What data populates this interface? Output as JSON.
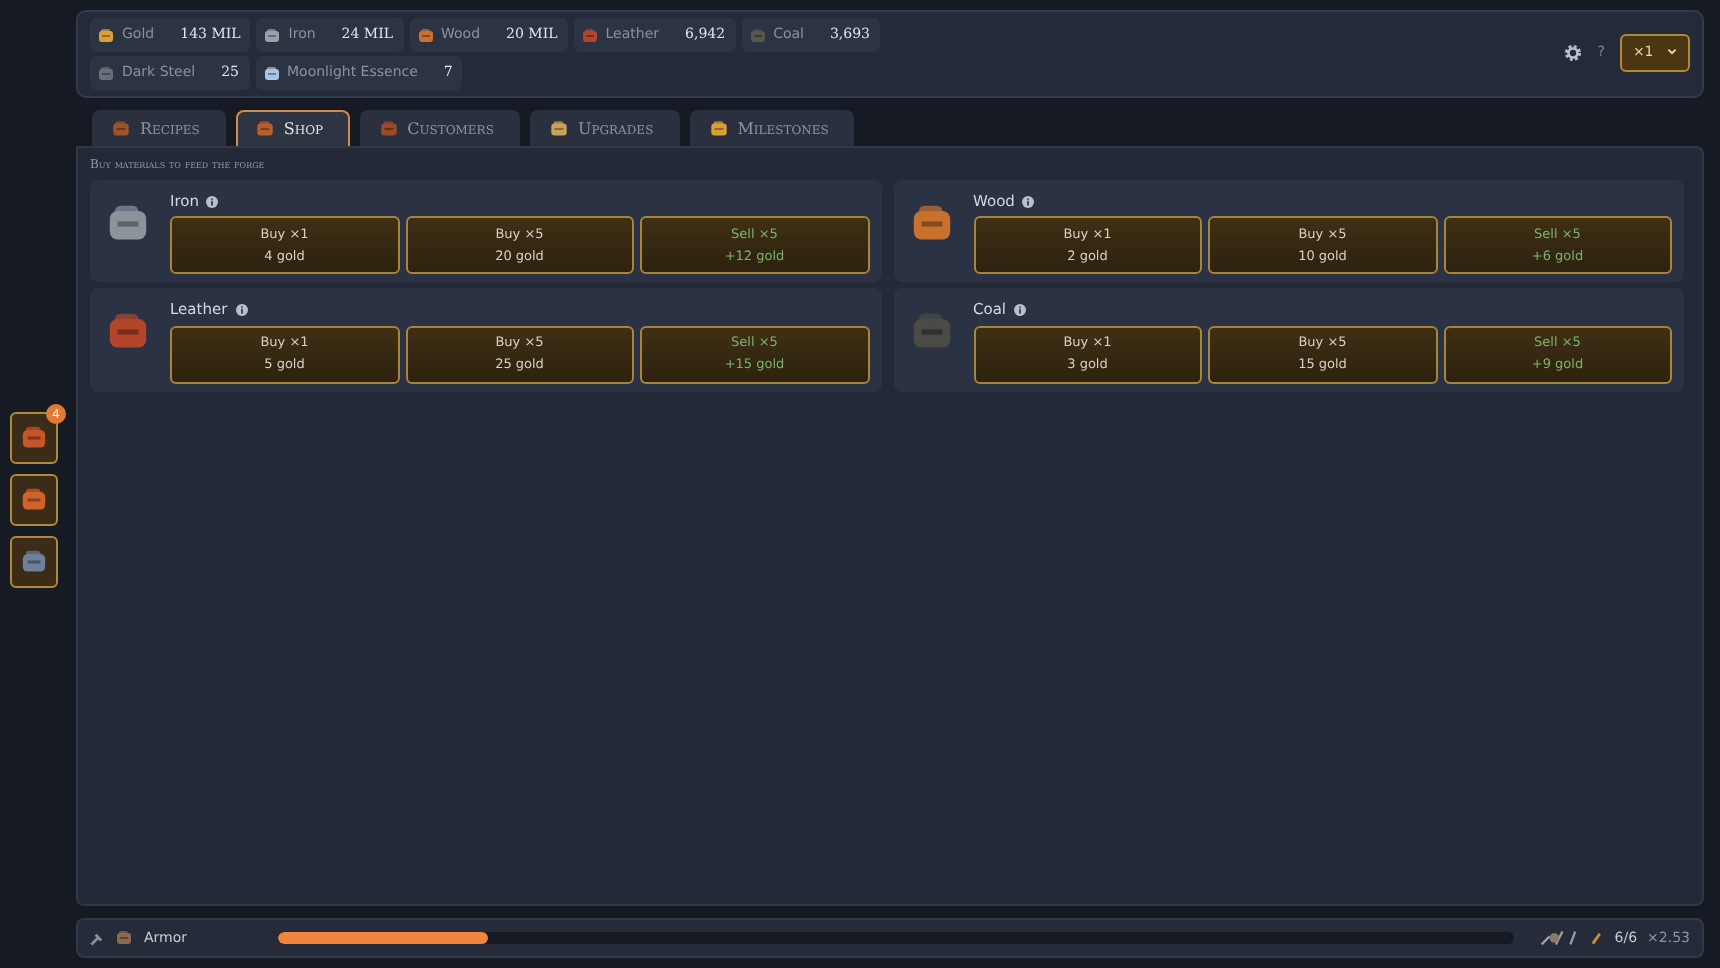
{
  "resources": [
    {
      "label": "Gold",
      "value": "143 MIL",
      "color": "#d9a03a"
    },
    {
      "label": "Iron",
      "value": "24 MIL",
      "color": "#9aa0a8"
    },
    {
      "label": "Wood",
      "value": "20 MIL",
      "color": "#c9712e"
    },
    {
      "label": "Leather",
      "value": "6,942",
      "color": "#b2452a"
    },
    {
      "label": "Coal",
      "value": "3,693",
      "color": "#55584f"
    },
    {
      "label": "Dark Steel",
      "value": "25",
      "color": "#6c6f78"
    },
    {
      "label": "Moonlight Essence",
      "value": "7",
      "color": "#a9c4e6"
    }
  ],
  "help": "?",
  "multiplier": "×1",
  "tabs": [
    {
      "label": "Recipes",
      "selected": false
    },
    {
      "label": "Shop",
      "selected": true
    },
    {
      "label": "Customers",
      "selected": false
    },
    {
      "label": "Upgrades",
      "selected": false
    },
    {
      "label": "Milestones",
      "selected": false
    }
  ],
  "section_title": "Buy materials to feed the forge",
  "materials": [
    {
      "name": "Iron",
      "color": "#8d939b",
      "actions": [
        {
          "kind": "buy",
          "label": "Buy ×1",
          "price": "4 gold"
        },
        {
          "kind": "buy",
          "label": "Buy ×5",
          "price": "20 gold"
        },
        {
          "kind": "sell",
          "label": "Sell ×5",
          "price": "+12 gold"
        }
      ]
    },
    {
      "name": "Wood",
      "color": "#c9712e",
      "actions": [
        {
          "kind": "buy",
          "label": "Buy ×1",
          "price": "2 gold"
        },
        {
          "kind": "buy",
          "label": "Buy ×5",
          "price": "10 gold"
        },
        {
          "kind": "sell",
          "label": "Sell ×5",
          "price": "+6 gold"
        }
      ]
    },
    {
      "name": "Leather",
      "color": "#b2452a",
      "actions": [
        {
          "kind": "buy",
          "label": "Buy ×1",
          "price": "5 gold"
        },
        {
          "kind": "buy",
          "label": "Buy ×5",
          "price": "25 gold"
        },
        {
          "kind": "sell",
          "label": "Sell ×5",
          "price": "+15 gold"
        }
      ]
    },
    {
      "name": "Coal",
      "color": "#4a4b46",
      "actions": [
        {
          "kind": "buy",
          "label": "Buy ×1",
          "price": "3 gold"
        },
        {
          "kind": "buy",
          "label": "Buy ×5",
          "price": "15 gold"
        },
        {
          "kind": "sell",
          "label": "Sell ×5",
          "price": "+9 gold"
        }
      ]
    }
  ],
  "side_buttons": [
    {
      "badge": "4",
      "color": "#c4562a"
    },
    {
      "color": "#d2622c"
    },
    {
      "color": "#6f7f9c"
    }
  ],
  "crafting": {
    "item": "Armor",
    "level": 0.17,
    "progress": "6/6",
    "rate": "×2.53"
  }
}
